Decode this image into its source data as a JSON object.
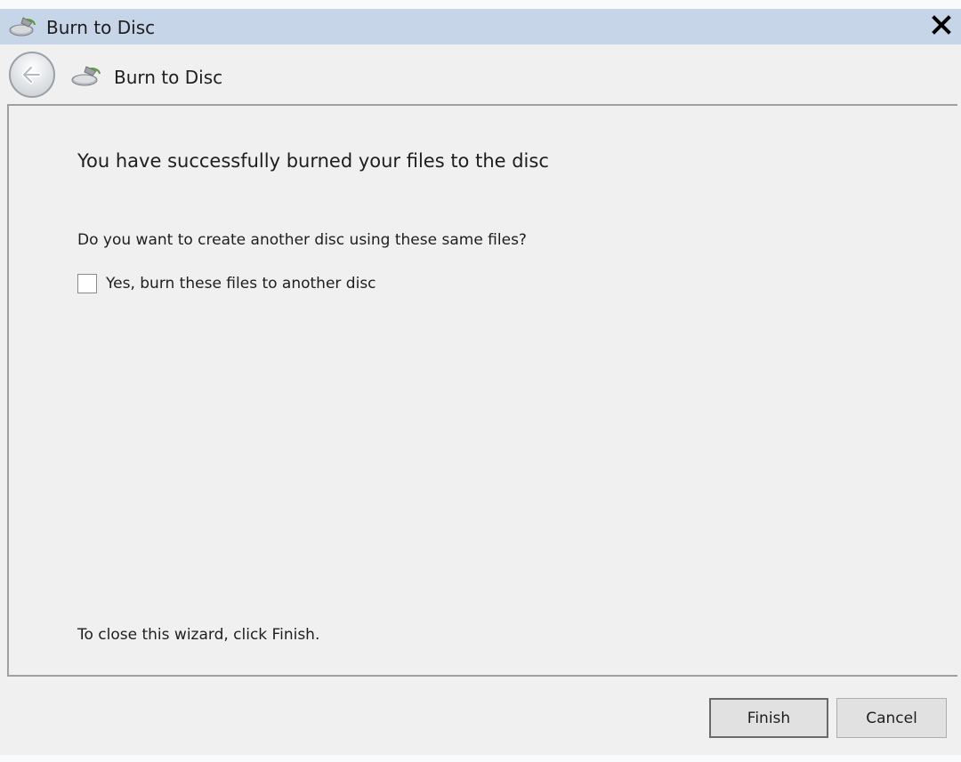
{
  "window": {
    "title": "Burn to Disc",
    "close_glyph": "✕",
    "icons": {
      "title": "disc-burner-icon",
      "back": "back-arrow-icon",
      "close": "close-icon"
    }
  },
  "header": {
    "title": "Burn to Disc"
  },
  "content": {
    "heading": "You have successfully burned your files to the disc",
    "question": "Do you want to create another disc using these same files?",
    "checkbox_label": "Yes, burn these files to another disc",
    "checkbox_checked": false,
    "footer_note": "To close this wizard, click Finish."
  },
  "buttons": {
    "finish": "Finish",
    "cancel": "Cancel"
  },
  "colors": {
    "titlebar": "#c6d6e8",
    "background": "#f0f0f0",
    "button_face": "#e1e1e1"
  }
}
